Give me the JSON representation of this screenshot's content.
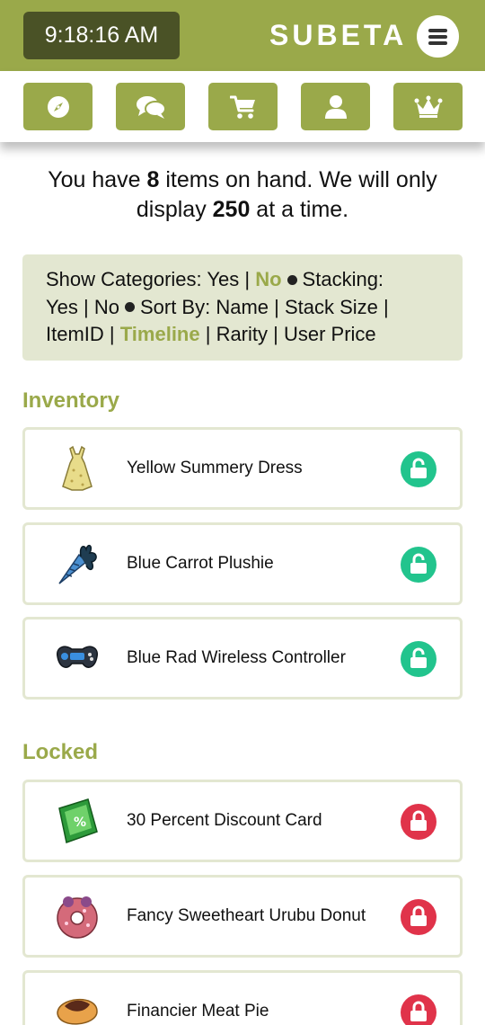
{
  "header": {
    "clock": "9:18:16 AM",
    "brand": "SUBETA",
    "accent": "#9aa94a",
    "clock_bg": "#4a5226"
  },
  "nav": {
    "items": [
      {
        "icon": "compass-icon"
      },
      {
        "icon": "chat-bubbles-icon"
      },
      {
        "icon": "shopping-cart-icon"
      },
      {
        "icon": "user-icon"
      },
      {
        "icon": "crown-icon"
      }
    ]
  },
  "intro": {
    "part1": "You have ",
    "count": "8",
    "part2": " items on hand. We will only display ",
    "limit": "250",
    "part3": " at a time."
  },
  "options": {
    "show_categories_label": "Show Categories: ",
    "yes": "Yes",
    "no_selected": "No",
    "stacking_label": "Stacking:",
    "stack_yes": "Yes",
    "stack_no": "No",
    "sort_label": "Sort By: ",
    "sort_name": "Name",
    "sort_stack": "Stack Size",
    "sort_itemid": "ItemID",
    "sort_timeline": "Timeline",
    "sort_rarity": "Rarity",
    "sort_price": "User Price",
    "separator": " | "
  },
  "sections": {
    "inventory": "Inventory",
    "locked": "Locked"
  },
  "inventory_items": [
    {
      "name": "Yellow Summery Dress",
      "icon": "dress-icon",
      "lock": "unlocked"
    },
    {
      "name": "Blue Carrot Plushie",
      "icon": "carrot-plushie-icon",
      "lock": "unlocked"
    },
    {
      "name": "Blue Rad Wireless Controller",
      "icon": "controller-icon",
      "lock": "unlocked"
    }
  ],
  "locked_items": [
    {
      "name": "30 Percent Discount Card",
      "icon": "discount-card-icon",
      "lock": "locked"
    },
    {
      "name": "Fancy Sweetheart Urubu Donut",
      "icon": "donut-icon",
      "lock": "locked"
    },
    {
      "name": "Financier Meat Pie",
      "icon": "meat-pie-icon",
      "lock": "locked"
    }
  ],
  "colors": {
    "unlocked": "#22c48d",
    "locked": "#e0334a",
    "panel": "#e3e7d1"
  }
}
